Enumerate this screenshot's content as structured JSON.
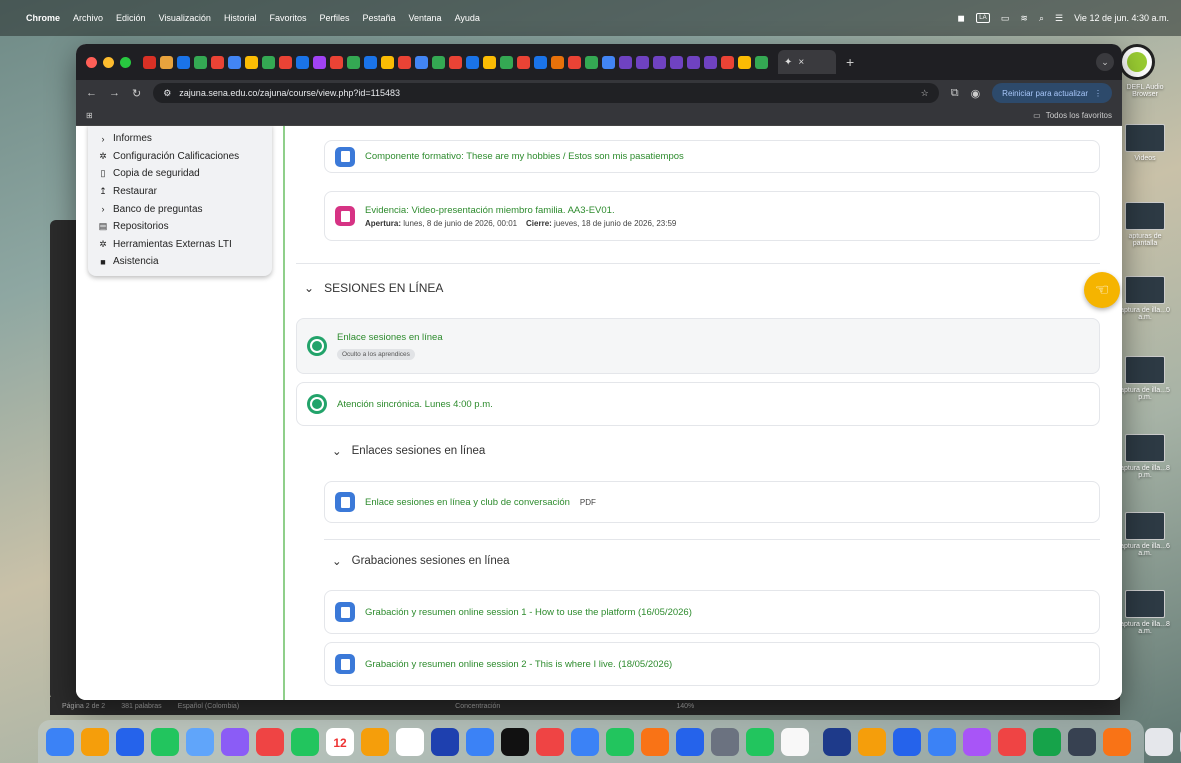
{
  "menubar": {
    "app": "Chrome",
    "items": [
      "Archivo",
      "Edición",
      "Visualización",
      "Historial",
      "Favoritos",
      "Perfiles",
      "Pestaña",
      "Ventana",
      "Ayuda"
    ],
    "clock": "Vie 12 de jun. 4:30 a.m.",
    "input_source": "LA"
  },
  "desktop": {
    "app_label": "DEFL Audio Browser",
    "items": [
      "Videos",
      "apturas de pantalla",
      "aptura de illa...0 a.m.",
      "aptura de illa...5 p.m.",
      "aptura de illa...8 p.m.",
      "aptura de illa...6 a.m.",
      "aptura de illa...8 a.m."
    ]
  },
  "chrome": {
    "url": "zajuna.sena.edu.co/zajuna/course/view.php?id=115483",
    "update_button": "Reiniciar para actualizar",
    "bookmarks_all": "Todos los favoritos"
  },
  "drawer": {
    "items": [
      {
        "label": "Informes",
        "icon": "chevron-right-icon",
        "glyph": "›",
        "sub": false
      },
      {
        "label": "Configuración Calificaciones",
        "icon": "gear-icon",
        "glyph": "✲",
        "sub": false
      },
      {
        "label": "Copia de seguridad",
        "icon": "file-icon",
        "glyph": "▯",
        "sub": false
      },
      {
        "label": "Restaurar",
        "icon": "restore-icon",
        "glyph": "↥",
        "sub": false
      },
      {
        "label": "Banco de preguntas",
        "icon": "chevron-right-icon",
        "glyph": "›",
        "sub": false
      },
      {
        "label": "Repositorios",
        "icon": "repository-icon",
        "glyph": "▤",
        "sub": false
      },
      {
        "label": "Herramientas Externas LTI",
        "icon": "gear-icon",
        "glyph": "✲",
        "sub": false
      },
      {
        "label": "Asistencia",
        "icon": "attendance-icon",
        "glyph": "■",
        "sub": false
      }
    ]
  },
  "course": {
    "componente": "Componente formativo: These are my hobbies / Estos son mis pasatiempos",
    "evidencia": {
      "title": "Evidencia: Video-presentación miembro familia. AA3-EV01.",
      "apertura_label": "Apertura:",
      "apertura": "lunes, 8 de junio de 2026, 00:01",
      "cierre_label": "Cierre:",
      "cierre": "jueves, 18 de junio de 2026, 23:59"
    },
    "section_sesiones": "SESIONES EN LÍNEA",
    "enlace_sesiones": "Enlace sesiones en línea",
    "hidden_badge": "Oculto a los aprendices",
    "atencion": "Atención sincrónica. Lunes 4:00 p.m.",
    "sub_enlaces": "Enlaces sesiones en línea",
    "enlace_club": "Enlace sesiones en línea y club de conversación",
    "enlace_club_type": "PDF",
    "sub_grabaciones": "Grabaciones sesiones en línea",
    "grabacion1": "Grabación y resumen online session 1 - How to use the platform (16/05/2026)",
    "grabacion2": "Grabación y resumen online session 2 - This is where I live. (18/05/2026)"
  },
  "word_status": {
    "page": "Página 2 de 2",
    "words": "381 palabras",
    "lang": "Español (Colombia)",
    "focus": "Concentración",
    "zoom": "140%"
  },
  "colors": {
    "link_green": "#2d8b2d",
    "doc_blue": "#3b79d8",
    "evidence_pink": "#d63384",
    "help_yellow": "#f5b400"
  }
}
